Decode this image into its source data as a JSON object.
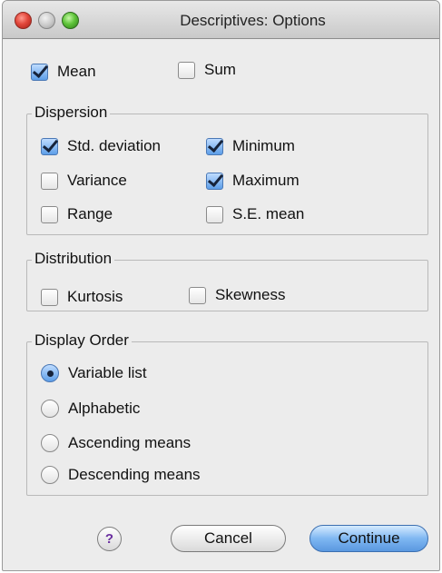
{
  "window": {
    "title": "Descriptives: Options"
  },
  "top_options": [
    {
      "label": "Mean",
      "checked": true
    },
    {
      "label": "Sum",
      "checked": false
    }
  ],
  "dispersion": {
    "legend": "Dispersion",
    "items": [
      {
        "label": "Std. deviation",
        "checked": true
      },
      {
        "label": "Minimum",
        "checked": true
      },
      {
        "label": "Variance",
        "checked": false
      },
      {
        "label": "Maximum",
        "checked": true
      },
      {
        "label": "Range",
        "checked": false
      },
      {
        "label": "S.E. mean",
        "checked": false
      }
    ]
  },
  "distribution": {
    "legend": "Distribution",
    "items": [
      {
        "label": "Kurtosis",
        "checked": false
      },
      {
        "label": "Skewness",
        "checked": false
      }
    ]
  },
  "display_order": {
    "legend": "Display Order",
    "options": [
      {
        "label": "Variable list",
        "selected": true
      },
      {
        "label": "Alphabetic",
        "selected": false
      },
      {
        "label": "Ascending means",
        "selected": false
      },
      {
        "label": "Descending means",
        "selected": false
      }
    ]
  },
  "buttons": {
    "help": "?",
    "cancel": "Cancel",
    "continue": "Continue"
  },
  "colors": {
    "accent": "#5d9ee8",
    "close": "#e2473b",
    "zoom": "#5fc43a"
  }
}
